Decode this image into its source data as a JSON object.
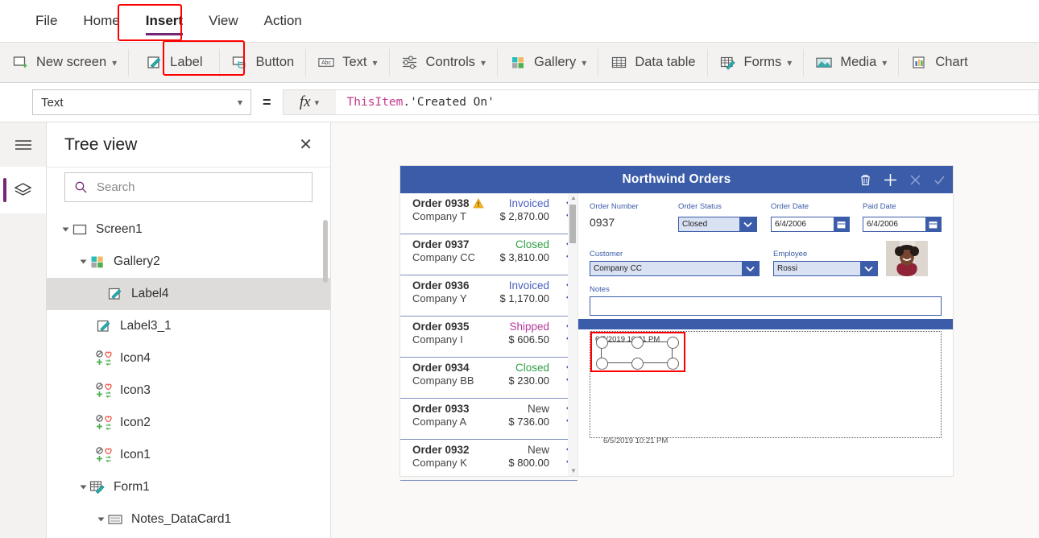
{
  "menu": {
    "items": [
      {
        "label": "File",
        "active": false
      },
      {
        "label": "Home",
        "active": false
      },
      {
        "label": "Insert",
        "active": true
      },
      {
        "label": "View",
        "active": false
      },
      {
        "label": "Action",
        "active": false
      }
    ]
  },
  "ribbon": {
    "items": [
      {
        "label": "New screen",
        "icon": "new-screen-icon",
        "caret": true,
        "highlight": false
      },
      {
        "label": "Label",
        "icon": "label-icon",
        "caret": false,
        "highlight": true
      },
      {
        "label": "Button",
        "icon": "button-icon",
        "caret": false,
        "highlight": false
      },
      {
        "label": "Text",
        "icon": "text-abc-icon",
        "caret": true,
        "highlight": false
      },
      {
        "label": "Controls",
        "icon": "controls-sliders-icon",
        "caret": true,
        "highlight": false
      },
      {
        "label": "Gallery",
        "icon": "gallery-grid-icon",
        "caret": true,
        "highlight": false
      },
      {
        "label": "Data table",
        "icon": "data-table-icon",
        "caret": false,
        "highlight": false
      },
      {
        "label": "Forms",
        "icon": "forms-icon",
        "caret": true,
        "highlight": false
      },
      {
        "label": "Media",
        "icon": "media-image-icon",
        "caret": true,
        "highlight": false
      },
      {
        "label": "Chart",
        "icon": "chart-bar-icon",
        "caret": false,
        "highlight": false
      }
    ]
  },
  "formula_bar": {
    "property": "Text",
    "equals": "=",
    "fx": "fx",
    "formula_object": "ThisItem",
    "formula_rest": ".'Created On'"
  },
  "tree_panel": {
    "title": "Tree view",
    "close": "✕",
    "search_placeholder": "Search",
    "search_value": "",
    "nodes": [
      {
        "label": "Screen1",
        "indent": 0,
        "twisty": true,
        "icon": "screen-icon",
        "selected": false
      },
      {
        "label": "Gallery2",
        "indent": 1,
        "twisty": true,
        "icon": "gallery-grid-icon",
        "selected": false
      },
      {
        "label": "Label4",
        "indent": 2,
        "twisty": false,
        "icon": "label-icon",
        "selected": true
      },
      {
        "label": "Label3_1",
        "indent": 1,
        "twisty": false,
        "icon": "label-icon",
        "selected": false
      },
      {
        "label": "Icon4",
        "indent": 1,
        "twisty": false,
        "icon": "icon-set-icon",
        "selected": false
      },
      {
        "label": "Icon3",
        "indent": 1,
        "twisty": false,
        "icon": "icon-set-icon",
        "selected": false
      },
      {
        "label": "Icon2",
        "indent": 1,
        "twisty": false,
        "icon": "icon-set-icon",
        "selected": false
      },
      {
        "label": "Icon1",
        "indent": 1,
        "twisty": false,
        "icon": "icon-set-icon",
        "selected": false
      },
      {
        "label": "Form1",
        "indent": 1,
        "twisty": true,
        "icon": "form-icon",
        "selected": false
      },
      {
        "label": "Notes_DataCard1",
        "indent": 2,
        "twisty": true,
        "icon": "datacard-icon",
        "selected": false
      }
    ]
  },
  "app_preview": {
    "header": {
      "title": "Northwind Orders",
      "actions": [
        {
          "name": "delete-icon",
          "dim": false
        },
        {
          "name": "add-icon",
          "dim": false
        },
        {
          "name": "cancel-icon",
          "dim": true
        },
        {
          "name": "save-check-icon",
          "dim": true
        }
      ]
    },
    "orders": [
      {
        "order": "Order 0938",
        "company": "Company T",
        "status": "Invoiced",
        "status_color": "#4a5fc1",
        "amount": "$ 2,870.00",
        "warning": true
      },
      {
        "order": "Order 0937",
        "company": "Company CC",
        "status": "Closed",
        "status_color": "#2f9e44",
        "amount": "$ 3,810.00",
        "warning": false
      },
      {
        "order": "Order 0936",
        "company": "Company Y",
        "status": "Invoiced",
        "status_color": "#4a5fc1",
        "amount": "$ 1,170.00",
        "warning": false
      },
      {
        "order": "Order 0935",
        "company": "Company I",
        "status": "Shipped",
        "status_color": "#b4399b",
        "amount": "$ 606.50",
        "warning": false
      },
      {
        "order": "Order 0934",
        "company": "Company BB",
        "status": "Closed",
        "status_color": "#2f9e44",
        "amount": "$ 230.00",
        "warning": false
      },
      {
        "order": "Order 0933",
        "company": "Company A",
        "status": "New",
        "status_color": "#444444",
        "amount": "$ 736.00",
        "warning": false
      },
      {
        "order": "Order 0932",
        "company": "Company K",
        "status": "New",
        "status_color": "#444444",
        "amount": "$ 800.00",
        "warning": false
      }
    ],
    "form": {
      "order_number_label": "Order Number",
      "order_number_value": "0937",
      "order_status_label": "Order Status",
      "order_status_value": "Closed",
      "order_date_label": "Order Date",
      "order_date_value": "6/4/2006",
      "paid_date_label": "Paid Date",
      "paid_date_value": "6/4/2006",
      "customer_label": "Customer",
      "customer_value": "Company CC",
      "employee_label": "Employee",
      "employee_value": "Rossi",
      "notes_label": "Notes",
      "notes_value": ""
    },
    "selected_label": {
      "text": "6/5/2019 10:21 PM"
    },
    "timestamp": "6/5/2019 10:21 PM"
  },
  "colors": {
    "accent_purple": "#742774",
    "app_blue": "#3b5ca8",
    "selection_red": "#ff0000"
  }
}
